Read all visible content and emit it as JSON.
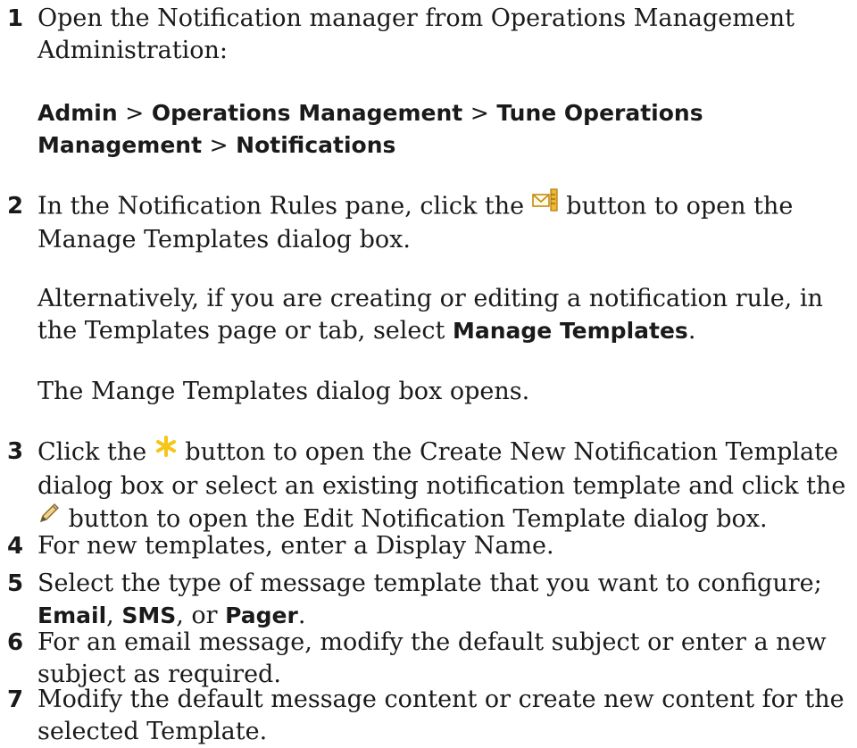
{
  "steps": {
    "s1": {
      "num": "1",
      "text": "Open the Notification manager from Operations Management Administration:",
      "path": {
        "p1": "Admin",
        "p2": "Operations Management",
        "p3": "Tune Operations Management",
        "p4": "Notifications",
        "sep": ">"
      }
    },
    "s2": {
      "num": "2",
      "pre": "In the Notification Rules pane, click the",
      "post": "button to open the Manage Templates dialog box.",
      "alt_pre": "Alternatively, if you are creating or editing a notification rule, in the Templates page or tab, select",
      "alt_bold": "Manage Templates",
      "alt_end": ".",
      "note": "The Mange Templates dialog box opens."
    },
    "s3": {
      "num": "3",
      "pre": "Click the",
      "mid": "button to open the Create New Notification Template dialog box or select an existing notification template and click the",
      "post": "button to open the Edit Notification Template dialog box."
    },
    "s4": {
      "num": "4",
      "text": "For new templates, enter a Display Name."
    },
    "s5": {
      "num": "5",
      "pre": "Select the type of message template that you want to configure;",
      "b1": "Email",
      "sep1": ",",
      "b2": "SMS",
      "sep2": ", or",
      "b3": "Pager",
      "end": "."
    },
    "s6": {
      "num": "6",
      "text": "For an email message, modify the default subject or enter a new subject as required."
    },
    "s7": {
      "num": "7",
      "text": "Modify the default message content or create new content for the selected Template."
    }
  },
  "icons": {
    "manage_templates": "manage-templates-icon",
    "new": "new-star-icon",
    "edit": "edit-pencil-icon"
  },
  "colors": {
    "text": "#1a1a1a",
    "star": "#f5c518",
    "template_icon": "#d99a1e"
  }
}
